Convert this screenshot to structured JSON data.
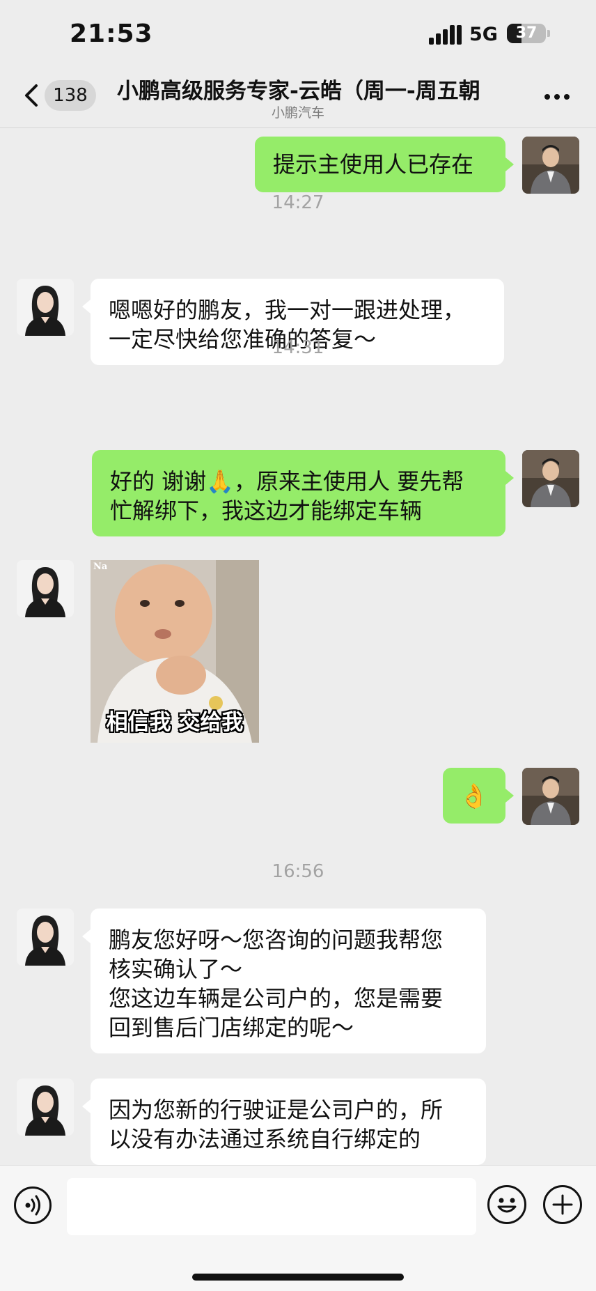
{
  "status_bar": {
    "time": "21:53",
    "network": "5G",
    "battery": "37",
    "battery_level": 0.37
  },
  "header": {
    "unread_count": "138",
    "title": "小鹏高级服务专家-云皓（周一-周五朝",
    "subtitle": "小鹏汽车",
    "back_icon": "chevron-left-icon",
    "more_icon": "ellipsis-icon"
  },
  "messages": [
    {
      "sender": "me",
      "type": "text",
      "lines": [
        "提示主使用人已存在"
      ]
    },
    {
      "type": "timestamp",
      "text": "14:27"
    },
    {
      "sender": "them",
      "type": "text",
      "lines": [
        "嗯嗯好的鹏友，我一对一跟进处理，",
        "一定尽快给您准确的答复～"
      ]
    },
    {
      "type": "timestamp",
      "text": "14:31"
    },
    {
      "sender": "me",
      "type": "text",
      "lines": [
        "好的 谢谢🙏，原来主使用人 要先帮",
        "忙解绑下，我这边才能绑定车辆"
      ]
    },
    {
      "sender": "them",
      "type": "sticker",
      "caption": "相信我 交给我",
      "mark": "Na"
    },
    {
      "sender": "me",
      "type": "emoji",
      "text": "👌"
    },
    {
      "type": "timestamp",
      "text": "16:56"
    },
    {
      "sender": "them",
      "type": "text",
      "lines": [
        "鹏友您好呀～您咨询的问题我帮您",
        "核实确认了～",
        "您这边车辆是公司户的，您是需要",
        "回到售后门店绑定的呢～"
      ]
    },
    {
      "sender": "them",
      "type": "text",
      "lines": [
        "因为您新的行驶证是公司户的，所",
        "以没有办法通过系统自行绑定的"
      ]
    }
  ],
  "input_bar": {
    "voice_icon": "voice-icon",
    "emoji_icon": "smiley-icon",
    "plus_icon": "plus-icon",
    "input_value": ""
  },
  "colors": {
    "my_bubble": "#95ec69",
    "their_bubble": "#ffffff",
    "background": "#ededed"
  }
}
